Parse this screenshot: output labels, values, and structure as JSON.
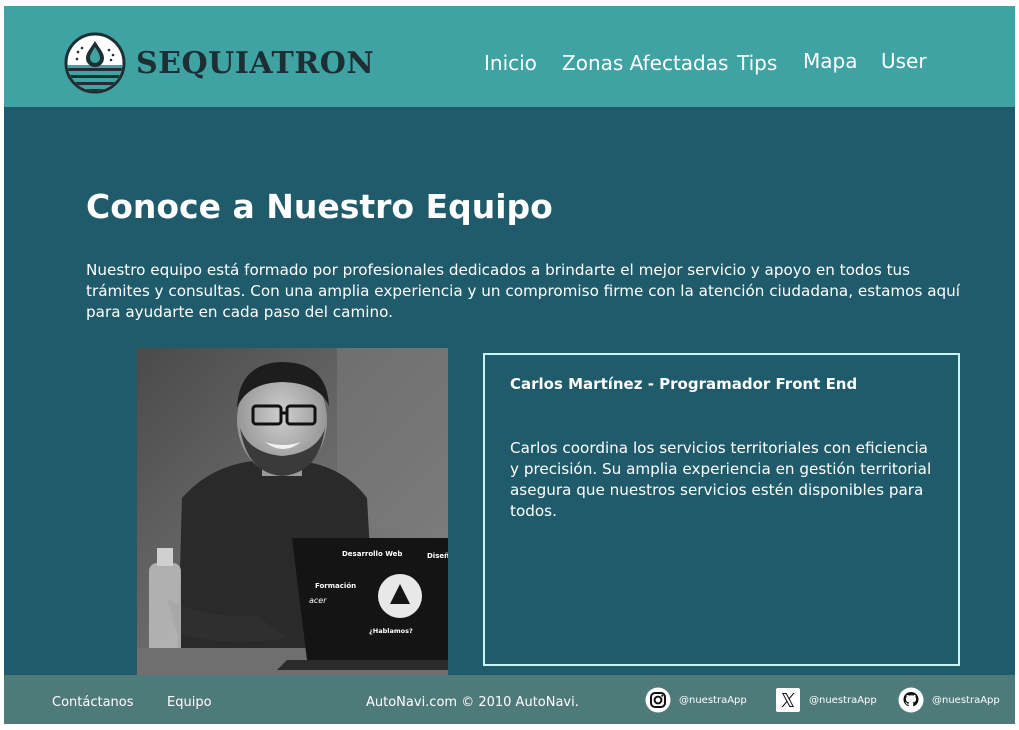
{
  "header": {
    "brand": "SEQUIATRON",
    "nav": [
      {
        "label": "Inicio"
      },
      {
        "label": "Zonas Afectadas"
      },
      {
        "label": "Tips"
      },
      {
        "label": "Mapa"
      },
      {
        "label": "User"
      }
    ]
  },
  "main": {
    "title": "Conoce a Nuestro Equipo",
    "intro": "Nuestro equipo está formado por profesionales dedicados a brindarte el mejor servicio y apoyo en todos tus trámites y consultas. Con una amplia experiencia y un compromiso firme con la atención ciudadana, estamos aquí para ayudarte en cada paso del camino.",
    "member": {
      "name_role": "Carlos Martínez - Programador Front End",
      "description": "Carlos coordina los servicios territoriales con eficiencia y precisión. Su amplia experiencia en gestión territorial asegura que nuestros servicios estén disponibles para todos.",
      "laptop_stickers": [
        "Desarrollo Web",
        "Diseñ",
        "Formación",
        "acer",
        "¿Hablamos?"
      ]
    }
  },
  "footer": {
    "links": [
      {
        "label": "Contáctanos"
      },
      {
        "label": "Equipo"
      }
    ],
    "copyright": "AutoNavi.com © 2010 AutoNavi.",
    "social": [
      {
        "icon": "instagram-icon",
        "handle": "@nuestraApp"
      },
      {
        "icon": "x-icon",
        "handle": "@nuestraApp"
      },
      {
        "icon": "github-icon",
        "handle": "@nuestraApp"
      }
    ]
  },
  "colors": {
    "header_bg": "#3fa3a4",
    "main_bg": "#1f5b6a",
    "footer_bg": "#4f7a7a",
    "card_border": "#c8f4f4",
    "brand_text": "#1e2f33"
  }
}
